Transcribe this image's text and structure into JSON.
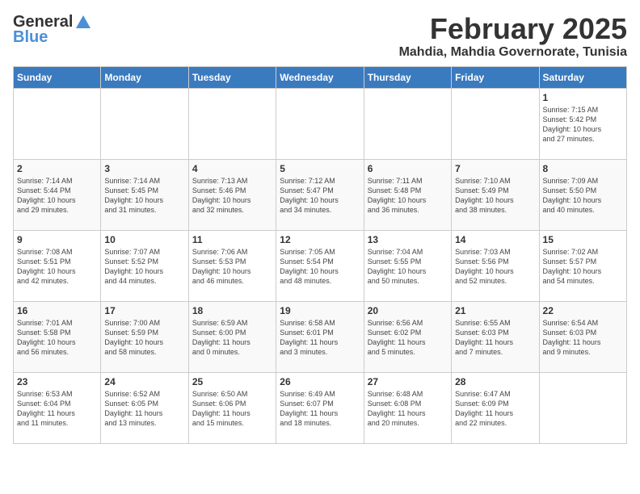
{
  "header": {
    "logo_general": "General",
    "logo_blue": "Blue",
    "month_title": "February 2025",
    "location": "Mahdia, Mahdia Governorate, Tunisia"
  },
  "days_of_week": [
    "Sunday",
    "Monday",
    "Tuesday",
    "Wednesday",
    "Thursday",
    "Friday",
    "Saturday"
  ],
  "weeks": [
    {
      "cells": [
        {
          "day": "",
          "info": ""
        },
        {
          "day": "",
          "info": ""
        },
        {
          "day": "",
          "info": ""
        },
        {
          "day": "",
          "info": ""
        },
        {
          "day": "",
          "info": ""
        },
        {
          "day": "",
          "info": ""
        },
        {
          "day": "1",
          "info": "Sunrise: 7:15 AM\nSunset: 5:42 PM\nDaylight: 10 hours\nand 27 minutes."
        }
      ]
    },
    {
      "cells": [
        {
          "day": "2",
          "info": "Sunrise: 7:14 AM\nSunset: 5:44 PM\nDaylight: 10 hours\nand 29 minutes."
        },
        {
          "day": "3",
          "info": "Sunrise: 7:14 AM\nSunset: 5:45 PM\nDaylight: 10 hours\nand 31 minutes."
        },
        {
          "day": "4",
          "info": "Sunrise: 7:13 AM\nSunset: 5:46 PM\nDaylight: 10 hours\nand 32 minutes."
        },
        {
          "day": "5",
          "info": "Sunrise: 7:12 AM\nSunset: 5:47 PM\nDaylight: 10 hours\nand 34 minutes."
        },
        {
          "day": "6",
          "info": "Sunrise: 7:11 AM\nSunset: 5:48 PM\nDaylight: 10 hours\nand 36 minutes."
        },
        {
          "day": "7",
          "info": "Sunrise: 7:10 AM\nSunset: 5:49 PM\nDaylight: 10 hours\nand 38 minutes."
        },
        {
          "day": "8",
          "info": "Sunrise: 7:09 AM\nSunset: 5:50 PM\nDaylight: 10 hours\nand 40 minutes."
        }
      ]
    },
    {
      "cells": [
        {
          "day": "9",
          "info": "Sunrise: 7:08 AM\nSunset: 5:51 PM\nDaylight: 10 hours\nand 42 minutes."
        },
        {
          "day": "10",
          "info": "Sunrise: 7:07 AM\nSunset: 5:52 PM\nDaylight: 10 hours\nand 44 minutes."
        },
        {
          "day": "11",
          "info": "Sunrise: 7:06 AM\nSunset: 5:53 PM\nDaylight: 10 hours\nand 46 minutes."
        },
        {
          "day": "12",
          "info": "Sunrise: 7:05 AM\nSunset: 5:54 PM\nDaylight: 10 hours\nand 48 minutes."
        },
        {
          "day": "13",
          "info": "Sunrise: 7:04 AM\nSunset: 5:55 PM\nDaylight: 10 hours\nand 50 minutes."
        },
        {
          "day": "14",
          "info": "Sunrise: 7:03 AM\nSunset: 5:56 PM\nDaylight: 10 hours\nand 52 minutes."
        },
        {
          "day": "15",
          "info": "Sunrise: 7:02 AM\nSunset: 5:57 PM\nDaylight: 10 hours\nand 54 minutes."
        }
      ]
    },
    {
      "cells": [
        {
          "day": "16",
          "info": "Sunrise: 7:01 AM\nSunset: 5:58 PM\nDaylight: 10 hours\nand 56 minutes."
        },
        {
          "day": "17",
          "info": "Sunrise: 7:00 AM\nSunset: 5:59 PM\nDaylight: 10 hours\nand 58 minutes."
        },
        {
          "day": "18",
          "info": "Sunrise: 6:59 AM\nSunset: 6:00 PM\nDaylight: 11 hours\nand 0 minutes."
        },
        {
          "day": "19",
          "info": "Sunrise: 6:58 AM\nSunset: 6:01 PM\nDaylight: 11 hours\nand 3 minutes."
        },
        {
          "day": "20",
          "info": "Sunrise: 6:56 AM\nSunset: 6:02 PM\nDaylight: 11 hours\nand 5 minutes."
        },
        {
          "day": "21",
          "info": "Sunrise: 6:55 AM\nSunset: 6:03 PM\nDaylight: 11 hours\nand 7 minutes."
        },
        {
          "day": "22",
          "info": "Sunrise: 6:54 AM\nSunset: 6:03 PM\nDaylight: 11 hours\nand 9 minutes."
        }
      ]
    },
    {
      "cells": [
        {
          "day": "23",
          "info": "Sunrise: 6:53 AM\nSunset: 6:04 PM\nDaylight: 11 hours\nand 11 minutes."
        },
        {
          "day": "24",
          "info": "Sunrise: 6:52 AM\nSunset: 6:05 PM\nDaylight: 11 hours\nand 13 minutes."
        },
        {
          "day": "25",
          "info": "Sunrise: 6:50 AM\nSunset: 6:06 PM\nDaylight: 11 hours\nand 15 minutes."
        },
        {
          "day": "26",
          "info": "Sunrise: 6:49 AM\nSunset: 6:07 PM\nDaylight: 11 hours\nand 18 minutes."
        },
        {
          "day": "27",
          "info": "Sunrise: 6:48 AM\nSunset: 6:08 PM\nDaylight: 11 hours\nand 20 minutes."
        },
        {
          "day": "28",
          "info": "Sunrise: 6:47 AM\nSunset: 6:09 PM\nDaylight: 11 hours\nand 22 minutes."
        },
        {
          "day": "",
          "info": ""
        }
      ]
    }
  ]
}
